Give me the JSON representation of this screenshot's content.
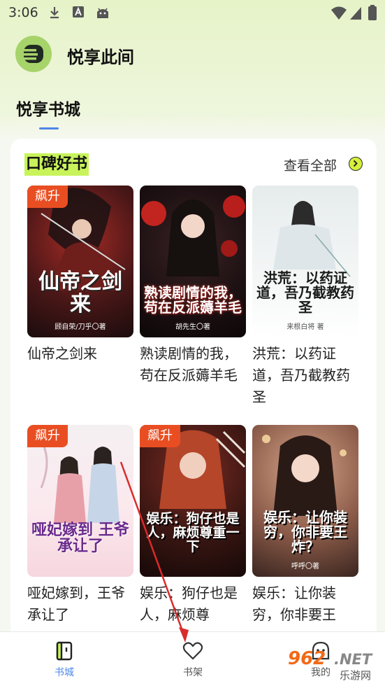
{
  "status_bar": {
    "time": "3:06"
  },
  "app": {
    "title": "悦享此间",
    "logo_icon": "book-b-logo"
  },
  "tabs": {
    "active": "悦享书城",
    "accent": "#4f87e8"
  },
  "section": {
    "title": "口碑好书",
    "highlight": "#c8f35a",
    "view_all": "查看全部"
  },
  "books": [
    {
      "badge": "飙升",
      "cover_title": "仙帝之剑来",
      "cover_author": "顾自荣/刀乎〇著",
      "title": "仙帝之剑来"
    },
    {
      "badge": "",
      "cover_title": "熟读剧情的我，苟在反派薅羊毛",
      "cover_author": "胡先生〇著",
      "title": "熟读剧情的我，苟在反派薅羊毛"
    },
    {
      "badge": "",
      "cover_title": "洪荒：以药证道，吾乃截教药圣",
      "cover_author": "来根白将 著",
      "title": "洪荒：以药证道，吾乃截教药圣"
    },
    {
      "badge": "飙升",
      "cover_title": "哑妃嫁到 王爷承让了",
      "cover_author": "",
      "title": "哑妃嫁到，王爷承让了"
    },
    {
      "badge": "飙升",
      "cover_title": "娱乐：狗仔也是人，麻烦尊重一下",
      "cover_author": "",
      "title": "娱乐：狗仔也是人，麻烦尊"
    },
    {
      "badge": "",
      "cover_title": "娱乐：让你装穷，你非要王炸？",
      "cover_author": "呼呼〇著",
      "title": "娱乐：让你装穷，你非要王"
    }
  ],
  "bottom_nav": [
    {
      "label": "书城",
      "icon": "book-icon",
      "active": true
    },
    {
      "label": "书架",
      "icon": "heart-icon",
      "active": false
    },
    {
      "label": "我的",
      "icon": "face-icon",
      "active": false
    }
  ],
  "watermark": {
    "brand": "962",
    "suffix": ".NET",
    "cn": "乐游网"
  },
  "colors": {
    "badge": "#e94e22",
    "nav_active": "#4f87e8",
    "nav_inactive": "#555555"
  }
}
